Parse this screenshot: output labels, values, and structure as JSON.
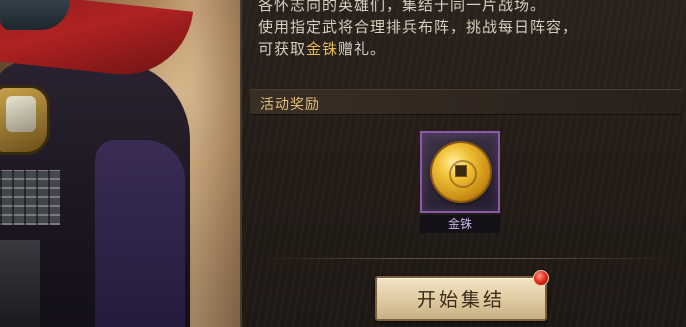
{
  "event": {
    "description_lines": [
      "各怀志向的英雄们，集结于同一片战场。",
      "使用指定武将合理排兵布阵，挑战每日阵容，",
      "可获取",
      "金铢",
      "赠礼。"
    ],
    "highlight_color": "#e6b85a"
  },
  "rewards_section": {
    "title": "活动奖励",
    "items": [
      {
        "name": "金铢",
        "icon": "gold-coin-icon",
        "rarity_color": "#8a5aa8"
      }
    ]
  },
  "actions": {
    "start_button": "开始集结",
    "has_notification": true
  }
}
